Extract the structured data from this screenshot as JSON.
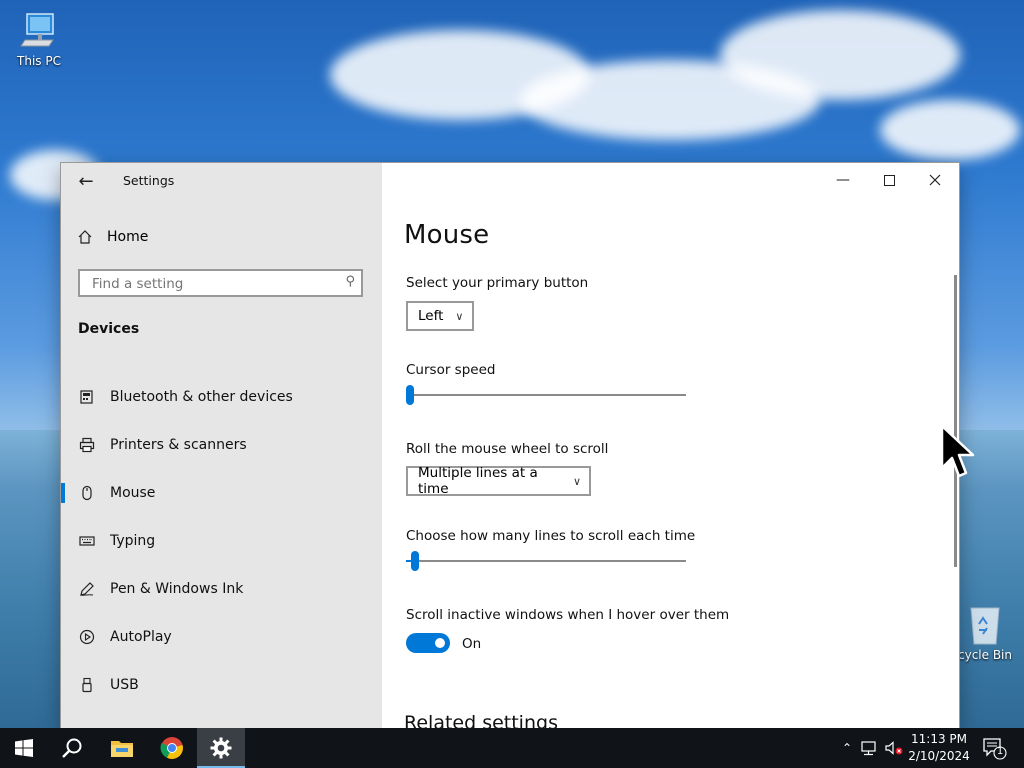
{
  "desktop": {
    "icons": {
      "this_pc": "This PC",
      "recycle_bin": "cycle Bin"
    }
  },
  "window": {
    "title": "Settings",
    "controls": {
      "minimize_icon": "minimize-icon",
      "maximize_icon": "maximize-icon",
      "close_icon": "close-icon"
    }
  },
  "sidebar": {
    "home_label": "Home",
    "search_placeholder": "Find a setting",
    "section_title": "Devices",
    "items": [
      {
        "label": "Bluetooth & other devices",
        "icon": "bluetooth-devices-icon"
      },
      {
        "label": "Printers & scanners",
        "icon": "printer-icon"
      },
      {
        "label": "Mouse",
        "icon": "mouse-icon",
        "active": true
      },
      {
        "label": "Typing",
        "icon": "keyboard-icon"
      },
      {
        "label": "Pen & Windows Ink",
        "icon": "pen-icon"
      },
      {
        "label": "AutoPlay",
        "icon": "autoplay-icon"
      },
      {
        "label": "USB",
        "icon": "usb-icon"
      }
    ]
  },
  "main": {
    "title": "Mouse",
    "primary_button": {
      "label": "Select your primary button",
      "value": "Left"
    },
    "cursor_speed": {
      "label": "Cursor speed",
      "level": 0.0
    },
    "scroll_mode": {
      "label": "Roll the mouse wheel to scroll",
      "value": "Multiple lines at a time"
    },
    "scroll_lines": {
      "label": "Choose how many lines to scroll each time",
      "level": 0.02
    },
    "inactive_scroll": {
      "label": "Scroll inactive windows when I hover over them",
      "state": "On"
    },
    "related_settings": "Related settings"
  },
  "taskbar": {
    "apps": [
      "start-icon",
      "search-icon",
      "file-explorer-icon",
      "chrome-icon",
      "settings-icon"
    ],
    "active_app": "settings-icon",
    "clock_time": "11:13 PM",
    "clock_date": "2/10/2024",
    "notification_count": "1"
  },
  "colors": {
    "accent": "#0078d7",
    "sidebar_bg": "#e6e6e6",
    "taskbar_bg": "#101418"
  }
}
